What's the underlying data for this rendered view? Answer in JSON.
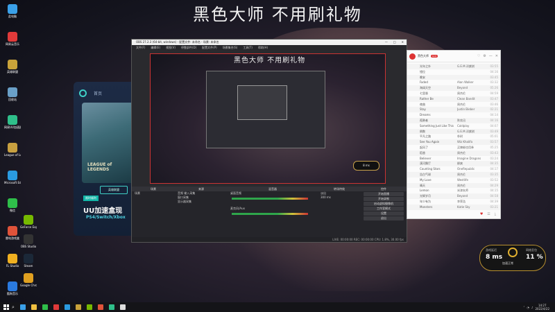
{
  "banner_text": "黑色大师 不用刷礼物",
  "desktop_icons": [
    {
      "label": "此电脑",
      "color": "#3aa0e8"
    },
    {
      "label": "网易云音乐",
      "color": "#e03a3a"
    },
    {
      "label": "英雄联盟",
      "color": "#c9a33a"
    },
    {
      "label": "回收站",
      "color": "#6aa0c8"
    },
    {
      "label": "网易UU加速器",
      "color": "#2fbf8a"
    },
    {
      "label": "League of Legends",
      "color": "#c8a040"
    },
    {
      "label": "Microsoft Edge",
      "color": "#2a9be0"
    },
    {
      "label": "微信",
      "color": "#2fbf4a"
    },
    {
      "label": "雷电游戏盒",
      "color": "#e0533a"
    },
    {
      "label": "FL Studio",
      "color": "#f0b020"
    },
    {
      "label": "酷狗音乐",
      "color": "#2a7ae0"
    },
    {
      "label": "GeForce Experience",
      "color": "#76b900"
    },
    {
      "label": "OBS Studio",
      "color": "#333"
    },
    {
      "label": "Steam",
      "color": "#1b2838"
    },
    {
      "label": "Google Chrome",
      "color": "#e0a020"
    }
  ],
  "promo": {
    "nav_label": "首页",
    "art_title": "LEAGUE of LEGENDS",
    "game_button": "英雄联盟",
    "ribbon": "限时福利",
    "headline": "UU加速盒现",
    "subline": "PS4/Switch/Xbox"
  },
  "obs": {
    "title": "OBS 27.2.3 (64-bit, windows) - 配置文件: 未命名 - 场景: 未命名",
    "menu": [
      "文件(F)",
      "编辑(E)",
      "视图(V)",
      "停靠部件(D)",
      "配置文件(P)",
      "场景集合(S)",
      "工具(T)",
      "帮助(H)"
    ],
    "preview_title": "黑色大师 不用刷礼物",
    "mini_dock": "8 ms",
    "docks": {
      "scenes_header": "场景",
      "sources_header": "来源",
      "mixer_header": "混音器",
      "transitions_header": "转场特效",
      "controls_header": "控件",
      "scene_item": "场景",
      "sources": [
        "音频 输入采集",
        "窗口采集",
        "显示器采集"
      ],
      "mixer_tracks": [
        "桌面音频",
        "麦克风/Aux"
      ],
      "transition_fade": "淡出",
      "transition_duration": "300 ms",
      "controls": [
        "开始直播",
        "开始录制",
        "启动虚拟摄像机",
        "工作室模式",
        "设置",
        "退出"
      ]
    },
    "status": "LIVE: 00:00:00  REC: 00:00:00  CPU: 1.8%, 30.00 fps"
  },
  "music": {
    "user": "黑色大师",
    "badge": "LV.9",
    "songs": [
      {
        "name": "光年之外",
        "artist": "G.E.M.邓紫棋",
        "dur": "03:55"
      },
      {
        "name": "错位",
        "artist": "",
        "dur": "04:16"
      },
      {
        "name": "晚安",
        "artist": "",
        "dur": "03:45"
      },
      {
        "name": "Faded",
        "artist": "Alan Walker",
        "dur": "03:32"
      },
      {
        "name": "海阔天空",
        "artist": "Beyond",
        "dur": "05:26"
      },
      {
        "name": "七里香",
        "artist": "周杰伦",
        "dur": "04:59"
      },
      {
        "name": "Rather Be",
        "artist": "Clean Bandit",
        "dur": "03:47"
      },
      {
        "name": "夜曲",
        "artist": "周杰伦",
        "dur": "03:46"
      },
      {
        "name": "Stay",
        "artist": "Justin Bieber",
        "dur": "02:21"
      },
      {
        "name": "Dreams",
        "artist": "",
        "dur": "04:14"
      },
      {
        "name": "孤勇者",
        "artist": "陈奕迅",
        "dur": "04:16"
      },
      {
        "name": "Something Just Like This",
        "artist": "Coldplay",
        "dur": "04:07"
      },
      {
        "name": "倒数",
        "artist": "G.E.M.邓紫棋",
        "dur": "03:49"
      },
      {
        "name": "平凡之路",
        "artist": "朴树",
        "dur": "05:01"
      },
      {
        "name": "See You Again",
        "artist": "Wiz Khalifa",
        "dur": "03:57"
      },
      {
        "name": "起风了",
        "artist": "买辣椒也用券",
        "dur": "05:25"
      },
      {
        "name": "稻香",
        "artist": "周杰伦",
        "dur": "03:43"
      },
      {
        "name": "Believer",
        "artist": "Imagine Dragons",
        "dur": "03:24"
      },
      {
        "name": "漠河舞厅",
        "artist": "柳爽",
        "dur": "04:35"
      },
      {
        "name": "Counting Stars",
        "artist": "OneRepublic",
        "dur": "04:17"
      },
      {
        "name": "告白气球",
        "artist": "周杰伦",
        "dur": "03:35"
      },
      {
        "name": "My Love",
        "artist": "Westlife",
        "dur": "03:52"
      },
      {
        "name": "晴天",
        "artist": "周杰伦",
        "dur": "04:29"
      },
      {
        "name": "Lemon",
        "artist": "米津玄师",
        "dur": "04:15"
      },
      {
        "name": "光辉岁月",
        "artist": "Beyond",
        "dur": "04:58"
      },
      {
        "name": "年少有为",
        "artist": "李荣浩",
        "dur": "04:39"
      },
      {
        "name": "Monsters",
        "artist": "Katie Sky",
        "dur": "03:21"
      }
    ]
  },
  "accel": {
    "left_label": "游戏延迟",
    "left_value": "8 ms",
    "right_label": "网络丢包",
    "right_value": "11 %",
    "center_label": "加速正常"
  },
  "taskbar": {
    "time": "14:27",
    "date": "2022/4/22",
    "apps": [
      "#3aa0e8",
      "#f0c040",
      "#2fbf4a",
      "#e03a3a",
      "#2a9be0",
      "#c9a33a",
      "#76b900",
      "#e0533a",
      "#2fbf8a",
      "#ddd"
    ]
  }
}
